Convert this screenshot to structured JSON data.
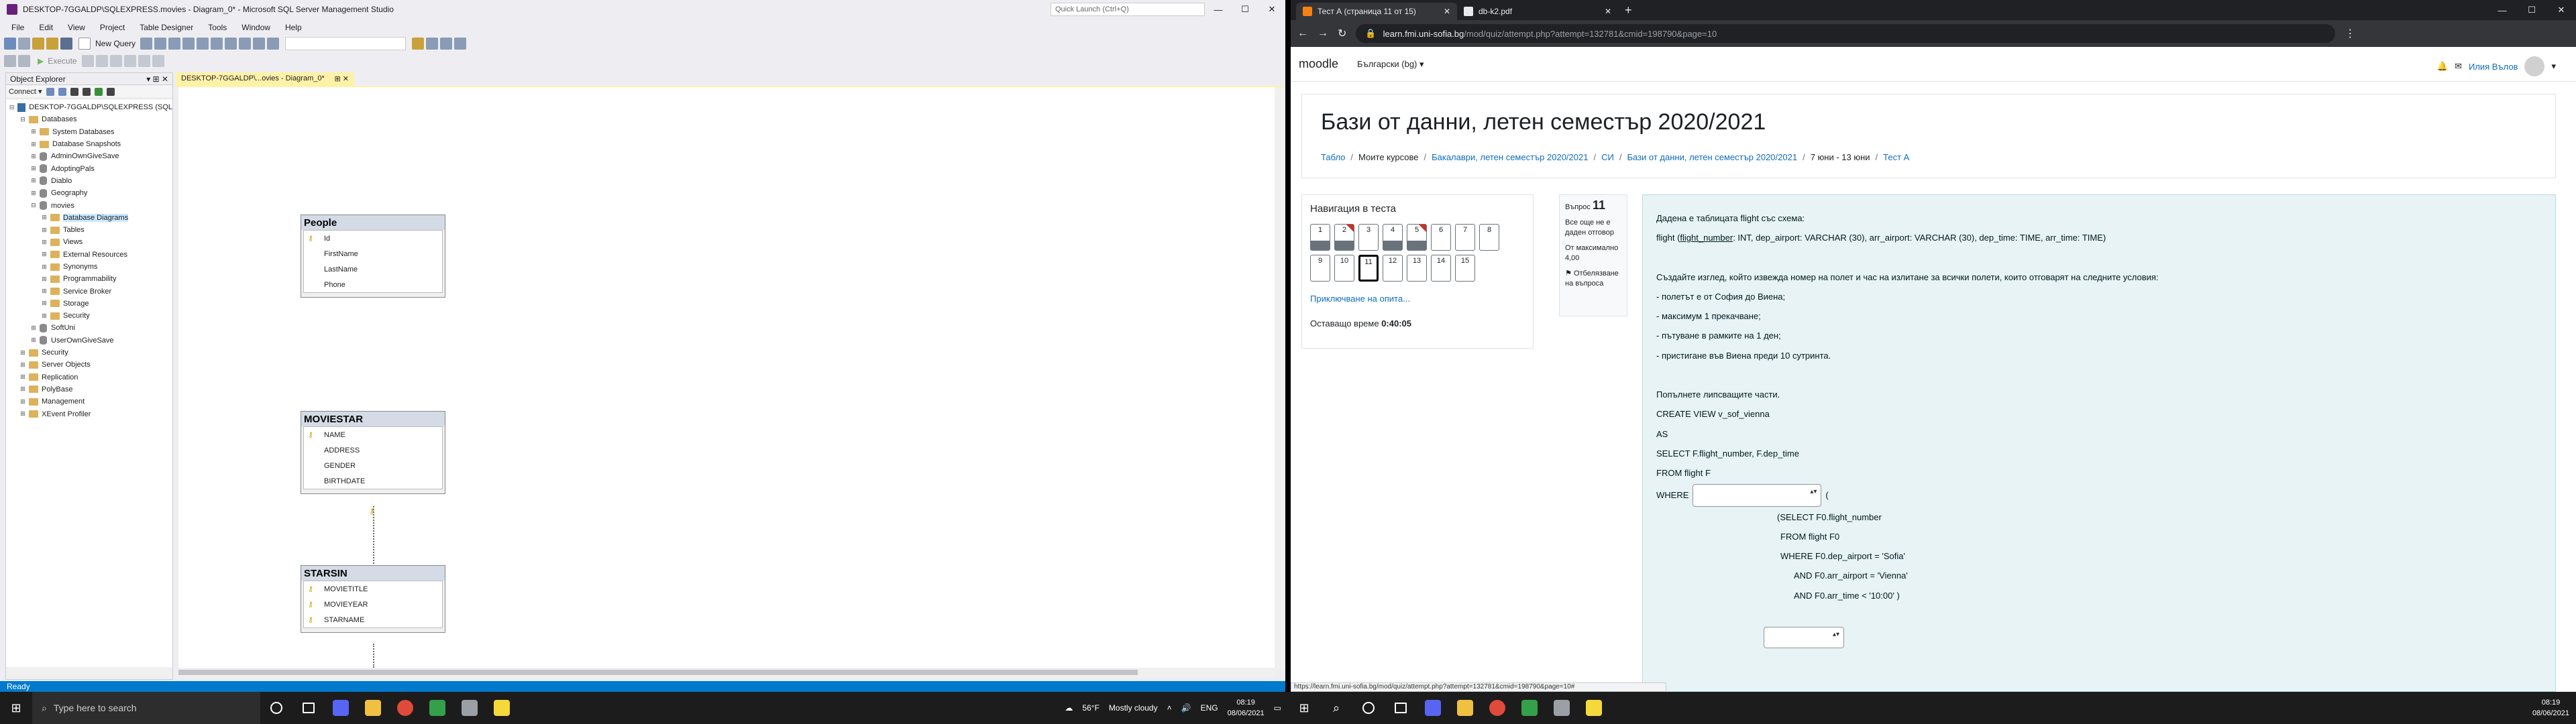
{
  "ssms": {
    "title": "DESKTOP-7GGALDP\\SQLEXPRESS.movies - Diagram_0* - Microsoft SQL Server Management Studio",
    "quick_launch": "Quick Launch (Ctrl+Q)",
    "menu": [
      "File",
      "Edit",
      "View",
      "Project",
      "Table Designer",
      "Tools",
      "Window",
      "Help"
    ],
    "toolbar": {
      "new_query": "New Query",
      "execute": "Execute"
    },
    "object_explorer": {
      "title": "Object Explorer",
      "connect": "Connect",
      "tree": [
        {
          "label": "DESKTOP-7GGALDP\\SQLEXPRESS (SQL",
          "icon": "server",
          "exp": "−",
          "indent": 0
        },
        {
          "label": "Databases",
          "icon": "folder",
          "exp": "−",
          "indent": 1
        },
        {
          "label": "System Databases",
          "icon": "folder",
          "exp": "+",
          "indent": 2
        },
        {
          "label": "Database Snapshots",
          "icon": "folder",
          "exp": "+",
          "indent": 2
        },
        {
          "label": "AdminOwnGiveSave",
          "icon": "db",
          "exp": "+",
          "indent": 2
        },
        {
          "label": "AdoptingPals",
          "icon": "db",
          "exp": "+",
          "indent": 2
        },
        {
          "label": "Diablo",
          "icon": "db",
          "exp": "+",
          "indent": 2
        },
        {
          "label": "Geography",
          "icon": "db",
          "exp": "+",
          "indent": 2
        },
        {
          "label": "movies",
          "icon": "db",
          "exp": "−",
          "indent": 2
        },
        {
          "label": "Database Diagrams",
          "icon": "folder",
          "exp": "+",
          "indent": 3,
          "selected": true
        },
        {
          "label": "Tables",
          "icon": "folder",
          "exp": "+",
          "indent": 3
        },
        {
          "label": "Views",
          "icon": "folder",
          "exp": "+",
          "indent": 3
        },
        {
          "label": "External Resources",
          "icon": "folder",
          "exp": "+",
          "indent": 3
        },
        {
          "label": "Synonyms",
          "icon": "folder",
          "exp": "+",
          "indent": 3
        },
        {
          "label": "Programmability",
          "icon": "folder",
          "exp": "+",
          "indent": 3
        },
        {
          "label": "Service Broker",
          "icon": "folder",
          "exp": "+",
          "indent": 3
        },
        {
          "label": "Storage",
          "icon": "folder",
          "exp": "+",
          "indent": 3
        },
        {
          "label": "Security",
          "icon": "folder",
          "exp": "+",
          "indent": 3
        },
        {
          "label": "SoftUni",
          "icon": "db",
          "exp": "+",
          "indent": 2
        },
        {
          "label": "UserOwnGiveSave",
          "icon": "db",
          "exp": "+",
          "indent": 2
        },
        {
          "label": "Security",
          "icon": "folder",
          "exp": "+",
          "indent": 1
        },
        {
          "label": "Server Objects",
          "icon": "folder",
          "exp": "+",
          "indent": 1
        },
        {
          "label": "Replication",
          "icon": "folder",
          "exp": "+",
          "indent": 1
        },
        {
          "label": "PolyBase",
          "icon": "folder",
          "exp": "+",
          "indent": 1
        },
        {
          "label": "Management",
          "icon": "folder",
          "exp": "+",
          "indent": 1
        },
        {
          "label": "XEvent Profiler",
          "icon": "folder",
          "exp": "+",
          "indent": 1
        }
      ]
    },
    "doc_tab": "DESKTOP-7GGALDP\\...ovies - Diagram_0*",
    "tables": {
      "people": {
        "name": "People",
        "cols": [
          {
            "n": "Id",
            "k": true
          },
          {
            "n": "FirstName",
            "k": false
          },
          {
            "n": "LastName",
            "k": false
          },
          {
            "n": "Phone",
            "k": false
          }
        ]
      },
      "moviestar": {
        "name": "MOVIESTAR",
        "cols": [
          {
            "n": "NAME",
            "k": true
          },
          {
            "n": "ADDRESS",
            "k": false
          },
          {
            "n": "GENDER",
            "k": false
          },
          {
            "n": "BIRTHDATE",
            "k": false
          }
        ]
      },
      "starsin": {
        "name": "STARSIN",
        "cols": [
          {
            "n": "MOVIETITLE",
            "k": true
          },
          {
            "n": "MOVIEYEAR",
            "k": true
          },
          {
            "n": "STARNAME",
            "k": true
          }
        ]
      }
    },
    "status": "Ready"
  },
  "chrome": {
    "tabs": [
      {
        "label": "Тест А (страница 11 от 15)",
        "active": true,
        "color": "#f98012"
      },
      {
        "label": "db-k2.pdf",
        "active": false,
        "color": "#e8eaed"
      }
    ],
    "url_host": "learn.fmi.uni-sofia.bg",
    "url_path": "/mod/quiz/attempt.php?attempt=132781&cmid=198790&page=10",
    "brand": "moodle",
    "language": "Български (bg)",
    "user": "Илия Вълов",
    "page_title": "Бази от данни, летен семестър 2020/2021",
    "breadcrumb": [
      {
        "t": "Табло",
        "link": true
      },
      {
        "t": "Моите курсове",
        "link": false
      },
      {
        "t": "Бакалаври, летен семестър 2020/2021",
        "link": true
      },
      {
        "t": "СИ",
        "link": true
      },
      {
        "t": "Бази от данни, летен семестър 2020/2021",
        "link": true
      },
      {
        "t": "7 юни - 13 юни",
        "link": false
      },
      {
        "t": "Тест А",
        "link": true
      }
    ],
    "quiz_nav": {
      "title": "Навигация в теста",
      "buttons": [
        {
          "n": "1",
          "answered": true,
          "flag": false,
          "cur": false
        },
        {
          "n": "2",
          "answered": true,
          "flag": true,
          "cur": false
        },
        {
          "n": "3",
          "answered": false,
          "flag": false,
          "cur": false
        },
        {
          "n": "4",
          "answered": true,
          "flag": false,
          "cur": false
        },
        {
          "n": "5",
          "answered": true,
          "flag": true,
          "cur": false
        },
        {
          "n": "6",
          "answered": false,
          "flag": false,
          "cur": false
        },
        {
          "n": "7",
          "answered": false,
          "flag": false,
          "cur": false
        },
        {
          "n": "8",
          "answered": false,
          "flag": false,
          "cur": false
        },
        {
          "n": "9",
          "answered": false,
          "flag": false,
          "cur": false
        },
        {
          "n": "10",
          "answered": false,
          "flag": false,
          "cur": false
        },
        {
          "n": "11",
          "answered": false,
          "flag": false,
          "cur": true
        },
        {
          "n": "12",
          "answered": false,
          "flag": false,
          "cur": false
        },
        {
          "n": "13",
          "answered": false,
          "flag": false,
          "cur": false
        },
        {
          "n": "14",
          "answered": false,
          "flag": false,
          "cur": false
        },
        {
          "n": "15",
          "answered": false,
          "flag": false,
          "cur": false
        }
      ],
      "finish_link": "Приключване на опита...",
      "time_label": "Оставащо време",
      "time_value": "0:40:05"
    },
    "qinfo": {
      "label": "Въпрос",
      "number": "11",
      "state": "Все още не е даден отговор",
      "points": "От максимално 4,00",
      "flag": "Отбелязване на въпроса"
    },
    "question": {
      "l1": "Дадена е таблицата flight със схема:",
      "l2a": "flight (",
      "l2b": "flight_number",
      "l2c": ": INT, dep_airport: VARCHAR (30), arr_airport: VARCHAR (30), dep_time: TIME, arr_time: TIME)",
      "l3": "Създайте изглед, който извежда номер на полет и час на излитане за всички полети, които отговарят на следните условия:",
      "c1": "- полетът е от София до Виена;",
      "c2": "- максимум 1 прекачване;",
      "c3": "- пътуване в рамките на 1 ден;",
      "c4": "- пристигане във Виена преди 10 сутринта.",
      "l4": "Попълнете липсващите части.",
      "s1": "CREATE VIEW v_sof_vienna",
      "s2": "AS",
      "s3": "SELECT F.flight_number, F.dep_time",
      "s4": "FROM flight F",
      "s5": "WHERE",
      "s6": "(",
      "s7": "(SELECT F0.flight_number",
      "s8": "FROM flight F0",
      "s9": "WHERE F0.dep_airport = 'Sofia'",
      "s10": "AND F0.arr_airport = 'Vienna'",
      "s11": "AND F0.arr_time < '10:00' )"
    },
    "status_url": "https://learn.fmi.uni-sofia.bg/mod/quiz/attempt.php?attempt=132781&cmid=198790&page=10#"
  },
  "taskbar": {
    "search": "Type here to search",
    "weather_temp": "56°F",
    "weather": "Mostly cloudy",
    "lang": "ENG",
    "time": "08:19",
    "date": "08/06/2021"
  }
}
